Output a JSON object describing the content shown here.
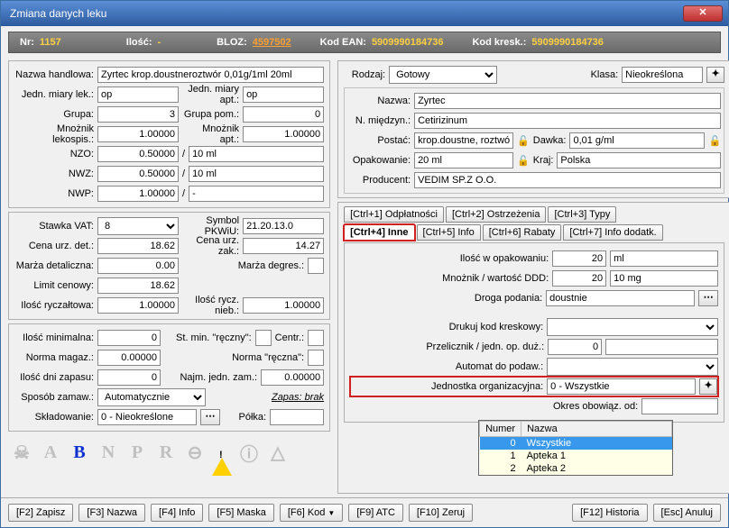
{
  "window": {
    "title": "Zmiana danych leku"
  },
  "info": {
    "nr_lbl": "Nr:",
    "nr": "1157",
    "ilosc_lbl": "Ilość:",
    "ilosc": "-",
    "bloz_lbl": "BLOZ:",
    "bloz": "4597502",
    "ean_lbl": "Kod EAN:",
    "ean": "5909990184736",
    "kresk_lbl": "Kod kresk.:",
    "kresk": "5909990184736"
  },
  "left1": {
    "nazwa_handlowa_lbl": "Nazwa handlowa:",
    "nazwa_handlowa": "Zyrtec krop.doustneroztwór 0,01g/1ml 20ml",
    "jedn_lek_lbl": "Jedn. miary lek.:",
    "jedn_lek": "op",
    "jedn_apt_lbl": "Jedn. miary apt.:",
    "jedn_apt": "op",
    "grupa_lbl": "Grupa:",
    "grupa": "3",
    "grupa_pom_lbl": "Grupa pom.:",
    "grupa_pom": "0",
    "mnoznik_lek_lbl": "Mnożnik lekospis.:",
    "mnoznik_lek": "1.00000",
    "mnoznik_apt_lbl": "Mnożnik apt.:",
    "mnoznik_apt": "1.00000",
    "nzo_lbl": "NZO:",
    "nzo": "0.50000",
    "nzo_unit": "10 ml",
    "nwz_lbl": "NWZ:",
    "nwz": "0.50000",
    "nwz_unit": "10 ml",
    "nwp_lbl": "NWP:",
    "nwp": "1.00000",
    "nwp_unit": "-"
  },
  "left2": {
    "stawka_vat_lbl": "Stawka VAT:",
    "stawka_vat": "8",
    "symbol_pkwiu_lbl": "Symbol PKWiU:",
    "symbol_pkwiu": "21.20.13.0",
    "cena_det_lbl": "Cena urz. det.:",
    "cena_det": "18.62",
    "cena_zak_lbl": "Cena urz. zak.:",
    "cena_zak": "14.27",
    "marza_det_lbl": "Marża detaliczna:",
    "marza_det": "0.00",
    "marza_degres_lbl": "Marża degres.:",
    "limit_lbl": "Limit cenowy:",
    "limit": "18.62",
    "ilosc_rycz_lbl": "Ilość ryczałtowa:",
    "ilosc_rycz": "1.00000",
    "ilosc_rycz_nieb_lbl": "Ilość rycz. nieb.:",
    "ilosc_rycz_nieb": "1.00000"
  },
  "left3": {
    "ilosc_min_lbl": "Ilość minimalna:",
    "ilosc_min": "0",
    "st_min_lbl": "St. min. \"ręczny\":",
    "centr_lbl": "Centr.:",
    "norma_mag_lbl": "Norma magaz.:",
    "norma_mag": "0.00000",
    "norma_reczna_lbl": "Norma \"ręczna\":",
    "ilosc_dni_lbl": "Ilość dni zapasu:",
    "ilosc_dni": "0",
    "najm_zam_lbl": "Najm. jedn. zam.:",
    "najm_zam": "0.00000",
    "sposob_zam_lbl": "Sposób zamaw.:",
    "sposob_zam": "Automatycznie",
    "zapas_lbl": "Zapas: brak",
    "skladowanie_lbl": "Składowanie:",
    "skladowanie": "0 - Nieokreślone",
    "polka_lbl": "Półka:"
  },
  "right_top": {
    "rodzaj_lbl": "Rodzaj:",
    "rodzaj": "Gotowy",
    "klasa_lbl": "Klasa:",
    "klasa": "Nieokreślona",
    "nazwa_lbl": "Nazwa:",
    "nazwa": "Zyrtec",
    "miedzyn_lbl": "N. międzyn.:",
    "miedzyn": "Cetirizinum",
    "postac_lbl": "Postać:",
    "postac": "krop.doustne, roztwó",
    "dawka_lbl": "Dawka:",
    "dawka": "0,01 g/ml",
    "opakowanie_lbl": "Opakowanie:",
    "opakowanie": "20 ml",
    "kraj_lbl": "Kraj:",
    "kraj": "Polska",
    "producent_lbl": "Producent:",
    "producent": "VEDIM SP.Z O.O."
  },
  "tabs": {
    "t1": "[Ctrl+1] Odpłatności",
    "t2": "[Ctrl+2] Ostrzeżenia",
    "t3": "[Ctrl+3] Typy",
    "t4": "[Ctrl+4] Inne",
    "t5": "[Ctrl+5] Info",
    "t6": "[Ctrl+6] Rabaty",
    "t7": "[Ctrl+7] Info dodatk."
  },
  "tab_inne": {
    "ilosc_opak_lbl": "Ilość w opakowaniu:",
    "ilosc_opak": "20",
    "ilosc_opak_unit": "ml",
    "mnoznik_ddd_lbl": "Mnożnik / wartość DDD:",
    "mnoznik_ddd": "20",
    "ddd_unit": "10 mg",
    "droga_lbl": "Droga podania:",
    "droga": "doustnie",
    "drukuj_lbl": "Drukuj kod kreskowy:",
    "przelicznik_lbl": "Przelicznik / jedn. op. duż.:",
    "przelicznik": "0",
    "automat_lbl": "Automat do podaw.:",
    "jednostka_org_lbl": "Jednostka organizacyjna:",
    "jednostka_org": "0 - Wszystkie",
    "okres_lbl": "Okres obowiąz. od:"
  },
  "dropdown": {
    "col_numer": "Numer",
    "col_nazwa": "Nazwa",
    "rows": [
      {
        "n": "0",
        "nm": "Wszystkie"
      },
      {
        "n": "1",
        "nm": "Apteka 1"
      },
      {
        "n": "2",
        "nm": "Apteka 2"
      }
    ]
  },
  "footer": {
    "f2": "[F2] Zapisz",
    "f3": "[F3] Nazwa",
    "f4": "[F4] Info",
    "f5": "[F5] Maska",
    "f6": "[F6] Kod",
    "f9": "[F9] ATC",
    "f10": "[F10] Zeruj",
    "f12": "[F12] Historia",
    "esc": "[Esc] Anuluj"
  }
}
